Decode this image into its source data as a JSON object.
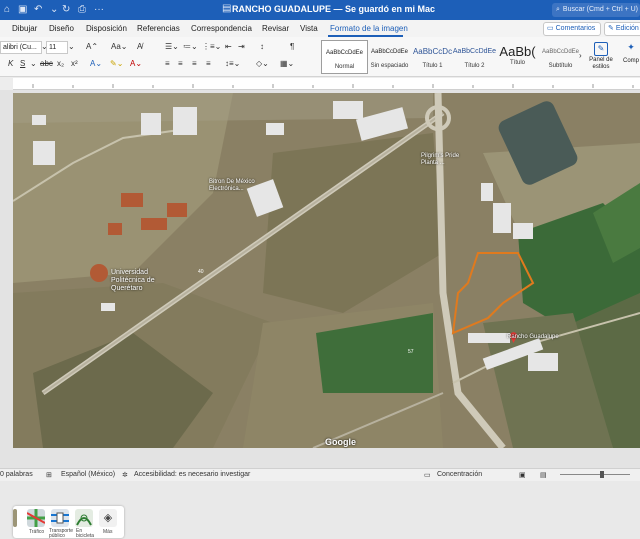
{
  "titlebar": {
    "title": "RANCHO GUADALUPE — Se guardó en mi Mac",
    "search_placeholder": "Buscar (Cmd + Ctrl + U)"
  },
  "menu": {
    "tabs": [
      "Dibujar",
      "Diseño",
      "Disposición",
      "Referencias",
      "Correspondencia",
      "Revisar",
      "Vista",
      "Formato de la imagen"
    ],
    "comments_label": "Comentarios",
    "edit_label": "Edición"
  },
  "ribbon": {
    "font_name": "alibri (Cu...",
    "font_size": "11",
    "styles": [
      {
        "preview": "AaBbCcDdEe",
        "name": "Normal"
      },
      {
        "preview": "AaBbCcDdEe",
        "name": "Sin espaciado"
      },
      {
        "preview": "AaBbCcDc",
        "name": "Título 1"
      },
      {
        "preview": "AaBbCcDdEe",
        "name": "Título 2"
      },
      {
        "preview": "AaBb(",
        "name": "Título"
      },
      {
        "preview": "AaBbCcDdEe",
        "name": "Subtítulo"
      }
    ],
    "styles_pane_label": "Panel de estilos",
    "compose_label": "Comp"
  },
  "map": {
    "labels": {
      "bitron": "Bitron De México Electrónica...",
      "pilgrims": "Pilgrim's Pride Planta ...",
      "university": "Universidad Politécnica de Querétaro",
      "rancho": "Rancho Guadalupe"
    },
    "google": "Google",
    "layers": [
      "",
      "Tráfico",
      "Transporte público",
      "En bicicleta",
      "Más"
    ]
  },
  "status": {
    "words": "0 palabras",
    "language": "Español (México)",
    "accessibility": "Accesibilidad: es necesario investigar",
    "focus": "Concentración"
  }
}
